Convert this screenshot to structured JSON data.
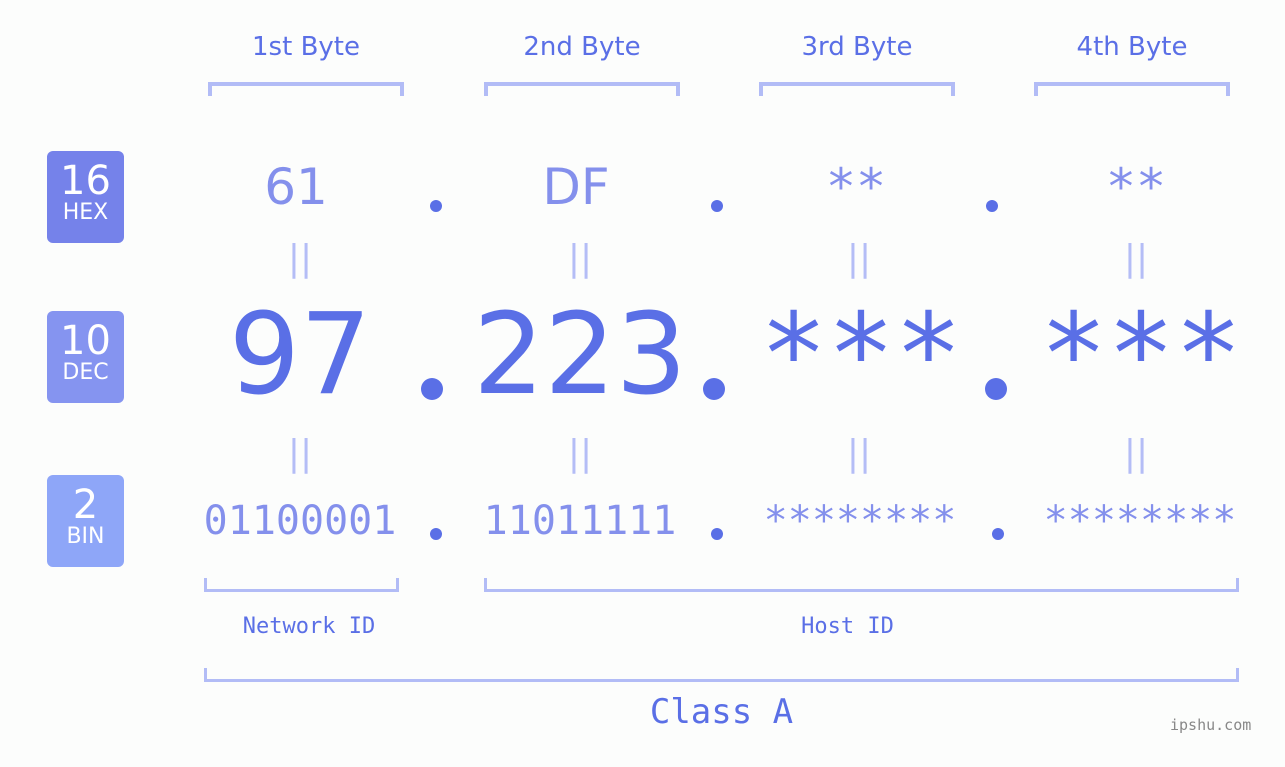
{
  "byte_headers": [
    "1st Byte",
    "2nd Byte",
    "3rd Byte",
    "4th Byte"
  ],
  "badges": [
    {
      "num": "16",
      "label": "HEX",
      "color": "#7582ea"
    },
    {
      "num": "10",
      "label": "DEC",
      "color": "#8594f0"
    },
    {
      "num": "2",
      "label": "BIN",
      "color": "#8ea6f8"
    }
  ],
  "hex": [
    "61",
    "DF",
    "**",
    "**"
  ],
  "dec": [
    "97",
    "223",
    "***",
    "***"
  ],
  "bin": [
    "01100001",
    "11011111",
    "********",
    "********"
  ],
  "equals_glyph": "||",
  "network_label": "Network ID",
  "host_label": "Host ID",
  "class_label": "Class A",
  "watermark": "ipshu.com",
  "colors": {
    "accent": "#5a6fe6",
    "light": "#8490ec",
    "bracket": "#b2bcf6"
  }
}
